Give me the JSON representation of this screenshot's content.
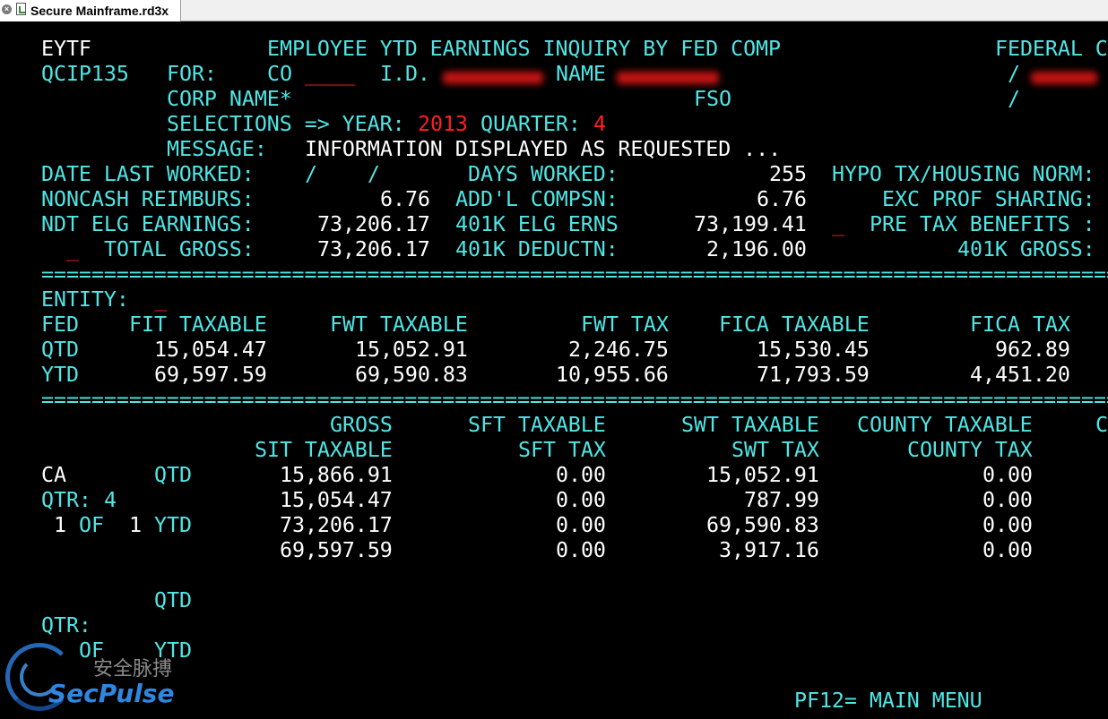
{
  "tab": {
    "close_icon": "close-icon",
    "title": "Secure Mainframe.rd3x"
  },
  "terminal": {
    "header": {
      "program": "EYTF",
      "title": "EMPLOYEE YTD EARNINGS INQUIRY BY FED COMP",
      "federal_label": "FEDERAL C",
      "screen_id": "QCIP135",
      "for_label": "FOR:",
      "co_label": "CO",
      "co_value": "____",
      "id_label": "I.D.",
      "name_label": "NAME",
      "slash1": "/",
      "corp_label": "CORP NAME*",
      "fso_label": "FSO",
      "slash2": "/",
      "selections_label": "SELECTIONS => YEAR:",
      "year": "2013",
      "quarter_label": "QUARTER:",
      "quarter": "4",
      "message_label": "MESSAGE:",
      "message": "INFORMATION DISPLAYED AS REQUESTED ..."
    },
    "summary": {
      "date_last_worked_label": "DATE LAST WORKED:",
      "date_last_worked": "/    /",
      "days_worked_label": "DAYS WORKED:",
      "days_worked": "255",
      "hypo_label": "HYPO TX/HOUSING NORM:",
      "noncash_label": "NONCASH REIMBURS:",
      "noncash": "6.76",
      "addl_label": "ADD'L COMPSN:",
      "addl": "6.76",
      "exc_label": "EXC PROF SHARING:",
      "ndt_label": "NDT ELG EARNINGS:",
      "ndt": "73,206.17",
      "elg_401k_label": "401K ELG ERNS",
      "elg_401k": "73,199.41",
      "pretax_flag": "_",
      "pretax_label": "PRE TAX BENEFITS :",
      "total_flag": "_",
      "total_gross_label": "TOTAL GROSS:",
      "total_gross": "73,206.17",
      "deductn_401k_label": "401K DEDUCTN:",
      "deductn_401k": "2,196.00",
      "gross_401k_label": "401K GROSS:"
    },
    "separator": "==========================================================================================",
    "entity_label": "ENTITY:",
    "entity_value": "_",
    "fed": {
      "headers": [
        "FED",
        "FIT TAXABLE",
        "FWT TAXABLE",
        "FWT TAX",
        "FICA TAXABLE",
        "FICA TAX"
      ],
      "rows": [
        [
          "QTD",
          "15,054.47",
          "15,052.91",
          "2,246.75",
          "15,530.45",
          "962.89"
        ],
        [
          "YTD",
          "69,597.59",
          "69,590.83",
          "10,955.66",
          "71,793.59",
          "4,451.20"
        ]
      ]
    },
    "state": {
      "header1": [
        "GROSS",
        "SFT TAXABLE",
        "SWT TAXABLE",
        "COUNTY TAXABLE",
        "C"
      ],
      "header2": [
        "SIT TAXABLE",
        "SFT TAX",
        "SWT TAX",
        "COUNTY TAX"
      ],
      "state_code": "CA",
      "qtd_label": "QTD",
      "qtr_label": "QTR:",
      "qtr_value": "4",
      "page_cur": "1",
      "of_label": "OF",
      "page_total": "1",
      "ytd_label": "YTD",
      "rows": [
        [
          "15,866.91",
          "0.00",
          "15,052.91",
          "0.00"
        ],
        [
          "15,054.47",
          "0.00",
          "787.99",
          "0.00"
        ],
        [
          "73,206.17",
          "0.00",
          "69,590.83",
          "0.00"
        ],
        [
          "69,597.59",
          "0.00",
          "3,917.16",
          "0.00"
        ]
      ],
      "empty_qtd_label": "QTD",
      "empty_qtr_label": "QTR:",
      "empty_of_label": "OF",
      "empty_ytd_label": "YTD"
    },
    "footer": {
      "pf12": "PF12= MAIN MENU"
    }
  },
  "watermark": {
    "cn": "安全脉搏",
    "en": "SecPulse"
  }
}
